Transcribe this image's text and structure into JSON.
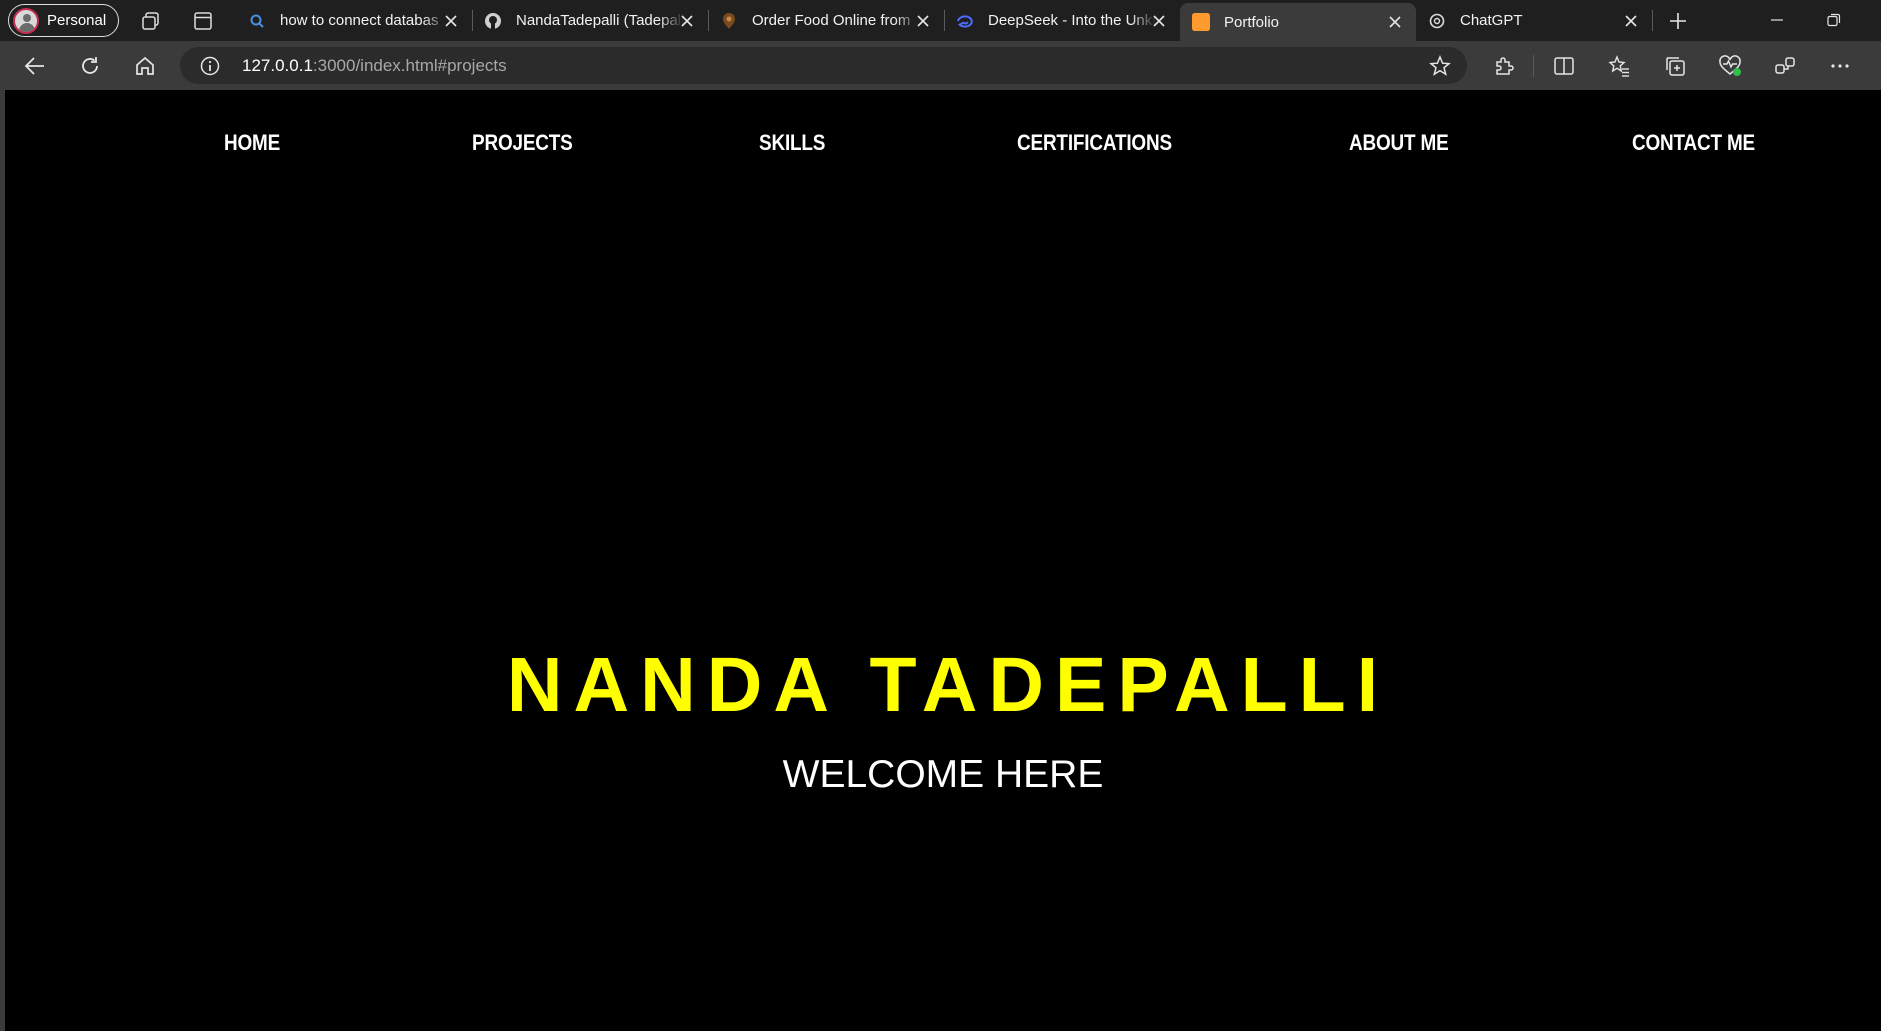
{
  "browser": {
    "profile_label": "Personal",
    "tabs": [
      {
        "title": "how to connect databas",
        "icon": "search-icon"
      },
      {
        "title": "NandaTadepalli (Tadepalli",
        "icon": "github-icon"
      },
      {
        "title": "Order Food Online from",
        "icon": "food-icon"
      },
      {
        "title": "DeepSeek - Into the Unknown",
        "icon": "deepseek-icon"
      },
      {
        "title": "Portfolio",
        "icon": "portfolio-icon"
      },
      {
        "title": "ChatGPT",
        "icon": "chatgpt-icon"
      }
    ],
    "url_host": "127.0.0.1",
    "url_rest": ":3000/index.html#projects"
  },
  "page": {
    "nav": [
      "HOME",
      "PROJECTS",
      "SKILLS",
      "CERTIFICATIONS",
      "ABOUT ME",
      "CONTACT ME"
    ],
    "hero_name": "NANDA TADEPALLI",
    "hero_subtitle": "WELCOME HERE"
  },
  "colors": {
    "accent": "#ffff00",
    "background": "#000000",
    "browser_chrome": "#3b3b3b"
  }
}
